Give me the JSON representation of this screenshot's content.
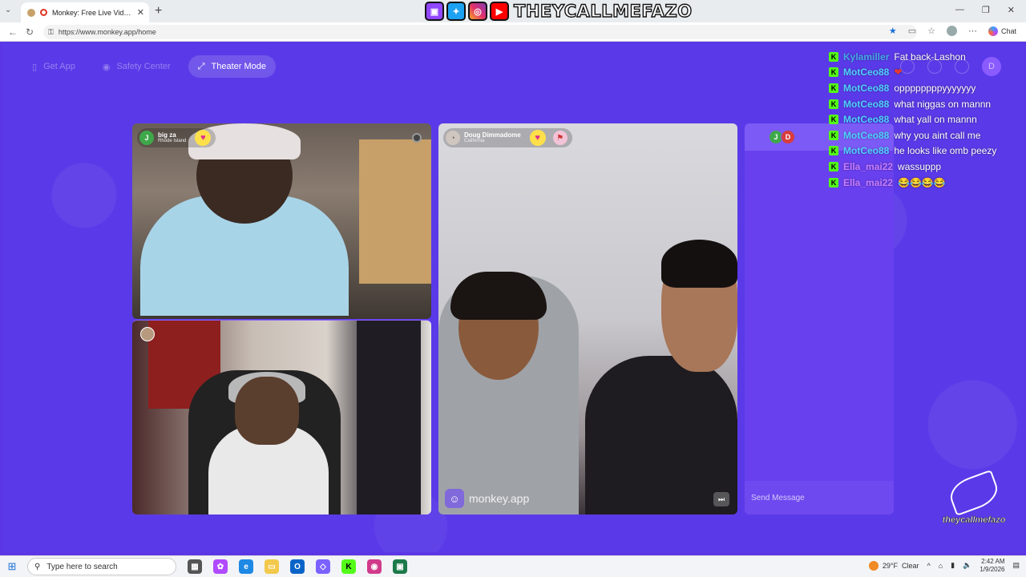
{
  "browser": {
    "tab_title": "Monkey: Free Live Video Chat",
    "url": "https://www.monkey.app/home",
    "copilot_label": "Chat"
  },
  "banner": {
    "channel": "THEYCALLMEFAZO",
    "icons": [
      "twitch-icon",
      "twitter-icon",
      "instagram-icon",
      "youtube-icon"
    ]
  },
  "nav": {
    "get_app": "Get App",
    "safety_center": "Safety Center",
    "theater_mode": "Theater Mode"
  },
  "profile_initial": "D",
  "tiles": {
    "user1": {
      "initial": "J",
      "name": "big za",
      "location": "Rhode Island"
    },
    "user2": {
      "name": "Doug Dimmadome",
      "location": "California"
    },
    "watermark": "monkey.app"
  },
  "chat_panel": {
    "avatars": [
      "J",
      "D"
    ],
    "placeholder": "Send Message"
  },
  "overlay_chat": [
    {
      "user": "Kylamiller",
      "text": "Fat back-Lashon",
      "color": "#46a8e8"
    },
    {
      "user": "MotCeo88",
      "text": "❤",
      "color": "#4fd2ff"
    },
    {
      "user": "MotCeo88",
      "text": "oppppppppyyyyyyy",
      "color": "#4fd2ff"
    },
    {
      "user": "MotCeo88",
      "text": "what niggas on mannn",
      "color": "#4fd2ff"
    },
    {
      "user": "MotCeo88",
      "text": "what yall on mannn",
      "color": "#4fd2ff"
    },
    {
      "user": "MotCeo88",
      "text": "why you aint call me",
      "color": "#4fd2ff"
    },
    {
      "user": "MotCeo88",
      "text": "he looks like omb peezy",
      "color": "#4fd2ff"
    },
    {
      "user": "Ella_mai22",
      "text": "wassuppp",
      "color": "#c77dff"
    },
    {
      "user": "Ella_mai22",
      "text": "😂😂😂😂",
      "color": "#c77dff"
    }
  ],
  "taskbar": {
    "search_placeholder": "Type here to search",
    "weather_temp": "29°F",
    "weather_desc": "Clear",
    "time": "2:42 AM",
    "date": "1/9/2026"
  },
  "colors": {
    "page_bg": "#5a3ae8",
    "kick_green": "#53fc18"
  }
}
